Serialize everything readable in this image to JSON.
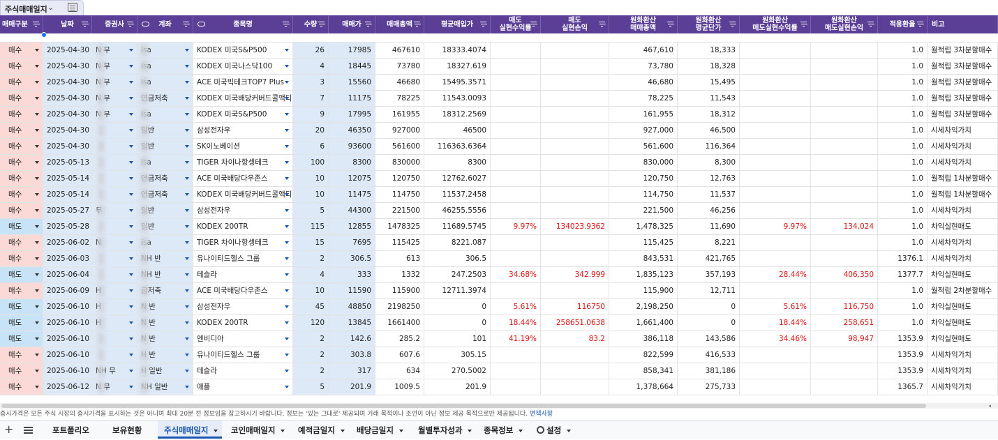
{
  "sheet_chip": {
    "name": "주식매매일지"
  },
  "headers": [
    "매매구분",
    "날짜",
    "증권사",
    "계좌",
    "종목명",
    "수량",
    "매매가",
    "매매총액",
    "평균매입가",
    "매도\n실현수익률",
    "매도\n실현손익",
    "원화환산\n매매총액",
    "원화환산\n평균단가",
    "원화환산\n매도실현수익률",
    "원화환산\n매도실현손익",
    "적용환율",
    "비고"
  ],
  "rows": [
    {
      "type": "매수",
      "date": "2025-04-30",
      "broker": "N  무",
      "account": "isa",
      "ticker": "KODEX 미국S&P500",
      "qty": "26",
      "price": "17985",
      "total": "467610",
      "avg": "18333.4074",
      "rr": "",
      "rp": "",
      "ktotal": "467,610",
      "kavg": "18,333",
      "krr": "",
      "krp": "",
      "fx": "1.0",
      "note": "월적립 3차분할매수"
    },
    {
      "type": "매수",
      "date": "2025-04-30",
      "broker": "N  무",
      "account": "isa",
      "ticker": "KODEX 미국나스닥100",
      "qty": "4",
      "price": "18445",
      "total": "73780",
      "avg": "18327.619",
      "rr": "",
      "rp": "",
      "ktotal": "73,780",
      "kavg": "18,328",
      "krr": "",
      "krp": "",
      "fx": "1.0",
      "note": "월적립 3차분할매수"
    },
    {
      "type": "매수",
      "date": "2025-04-30",
      "broker": "N  무",
      "account": "isa",
      "ticker": "ACE 미국빅테크TOP7 Plus",
      "qty": "3",
      "price": "15560",
      "total": "46680",
      "avg": "15495.3571",
      "rr": "",
      "rp": "",
      "ktotal": "46,680",
      "kavg": "15,495",
      "krr": "",
      "krp": "",
      "fx": "1.0",
      "note": "월적립 3차분할매수"
    },
    {
      "type": "매수",
      "date": "2025-04-30",
      "broker": "N  무",
      "account": "연금저축",
      "ticker": "KODEX 미국배당커버드콜액티!",
      "qty": "7",
      "price": "11175",
      "total": "78225",
      "avg": "11543.0093",
      "rr": "",
      "rp": "",
      "ktotal": "78,225",
      "kavg": "11,543",
      "krr": "",
      "krp": "",
      "fx": "1.0",
      "note": "월적립 3차분할매수"
    },
    {
      "type": "매수",
      "date": "2025-04-30",
      "broker": "N  무",
      "account": "isa",
      "ticker": "KODEX 미국S&P500",
      "qty": "9",
      "price": "17995",
      "total": "161955",
      "avg": "18312.2569",
      "rr": "",
      "rp": "",
      "ktotal": "161,955",
      "kavg": "18,312",
      "krr": "",
      "krp": "",
      "fx": "1.0",
      "note": "월적립 3차분할매수"
    },
    {
      "type": "매수",
      "date": "2025-04-30",
      "broker": "",
      "account": "일반",
      "ticker": "삼성전자우",
      "qty": "20",
      "price": "46350",
      "total": "927000",
      "avg": "46500",
      "rr": "",
      "rp": "",
      "ktotal": "927,000",
      "kavg": "46,500",
      "krr": "",
      "krp": "",
      "fx": "1.0",
      "note": "시세차익가치"
    },
    {
      "type": "매수",
      "date": "2025-04-30",
      "broker": "",
      "account": "일반",
      "ticker": "SK이노베이션",
      "qty": "6",
      "price": "93600",
      "total": "561600",
      "avg": "116363.6364",
      "rr": "",
      "rp": "",
      "ktotal": "561,600",
      "kavg": "116,364",
      "krr": "",
      "krp": "",
      "fx": "1.0",
      "note": "시세차익가치"
    },
    {
      "type": "매수",
      "date": "2025-05-13",
      "broker": "",
      "account": "isa",
      "ticker": "TIGER 차이나항셍테크",
      "qty": "100",
      "price": "8300",
      "total": "830000",
      "avg": "8300",
      "rr": "",
      "rp": "",
      "ktotal": "830,000",
      "kavg": "8,300",
      "krr": "",
      "krp": "",
      "fx": "1.0",
      "note": "시세차익가치"
    },
    {
      "type": "매수",
      "date": "2025-05-14",
      "broker": "",
      "account": "연금저축",
      "ticker": "ACE 미국배당다우존스",
      "qty": "10",
      "price": "12075",
      "total": "120750",
      "avg": "12762.6027",
      "rr": "",
      "rp": "",
      "ktotal": "120,750",
      "kavg": "12,763",
      "krr": "",
      "krp": "",
      "fx": "1.0",
      "note": "월적립 1차분할매수"
    },
    {
      "type": "매수",
      "date": "2025-05-14",
      "broker": "",
      "account": "연금저축",
      "ticker": "KODEX 미국배당커버드콜액티!",
      "qty": "10",
      "price": "11475",
      "total": "114750",
      "avg": "11537.2458",
      "rr": "",
      "rp": "",
      "ktotal": "114,750",
      "kavg": "11,537",
      "krr": "",
      "krp": "",
      "fx": "1.0",
      "note": "월적립 1차분할매수"
    },
    {
      "type": "매수",
      "date": "2025-05-27",
      "broker": "  무",
      "account": "일반",
      "ticker": "삼성전자우",
      "qty": "5",
      "price": "44300",
      "total": "221500",
      "avg": "46255.5556",
      "rr": "",
      "rp": "",
      "ktotal": "221,500",
      "kavg": "46,256",
      "krr": "",
      "krp": "",
      "fx": "1.0",
      "note": "시세차익가치"
    },
    {
      "type": "매도",
      "date": "2025-05-28",
      "broker": "",
      "account": "일반",
      "ticker": "KODEX 200TR",
      "qty": "115",
      "price": "12855",
      "total": "1478325",
      "avg": "11689.5745",
      "rr": "9.97%",
      "rp": "134023.9362",
      "ktotal": "1,478,325",
      "kavg": "11,690",
      "krr": "9.97%",
      "krp": "134,024",
      "fx": "1.0",
      "note": "차익실현매도"
    },
    {
      "type": "매수",
      "date": "2025-06-02",
      "broker": "N",
      "account": "isa",
      "ticker": "TIGER 차이나항셍테크",
      "qty": "15",
      "price": "7695",
      "total": "115425",
      "avg": "8221.087",
      "rr": "",
      "rp": "",
      "ktotal": "115,425",
      "kavg": "8,221",
      "krr": "",
      "krp": "",
      "fx": "1.0",
      "note": "시세차익가치"
    },
    {
      "type": "매수",
      "date": "2025-06-03",
      "broker": "",
      "account": "NH 반",
      "ticker": "유나이티드헬스 그룹",
      "qty": "2",
      "price": "306.5",
      "total": "613",
      "avg": "306.5",
      "rr": "",
      "rp": "",
      "ktotal": "843,531",
      "kavg": "421,765",
      "krr": "",
      "krp": "",
      "fx": "1376.1",
      "note": "시세차익가치"
    },
    {
      "type": "매도",
      "date": "2025-06-04",
      "broker": "",
      "account": "NH 반",
      "ticker": "테슬라",
      "qty": "4",
      "price": "333",
      "total": "1332",
      "avg": "247.2503",
      "rr": "34.68%",
      "rp": "342.999",
      "ktotal": "1,835,123",
      "kavg": "357,193",
      "krr": "28.44%",
      "krp": "406,350",
      "fx": "1377.7",
      "note": "차익실현매도"
    },
    {
      "type": "매수",
      "date": "2025-06-09",
      "broker": "H",
      "account": "금저축",
      "ticker": "ACE 미국배당다우존스",
      "qty": "10",
      "price": "11590",
      "total": "115900",
      "avg": "12711.3974",
      "rr": "",
      "rp": "",
      "ktotal": "115,900",
      "kavg": "12,711",
      "krr": "",
      "krp": "",
      "fx": "1.0",
      "note": "월적립 2차분할매수"
    },
    {
      "type": "매도",
      "date": "2025-06-10",
      "broker": "H",
      "account": "N 반",
      "ticker": "삼성전자우",
      "qty": "45",
      "price": "48850",
      "total": "2198250",
      "avg": "0",
      "rr": "5.61%",
      "rp": "116750",
      "ktotal": "2,198,250",
      "kavg": "0",
      "krr": "5.61%",
      "krp": "116,750",
      "fx": "1.0",
      "note": "차익실현매도"
    },
    {
      "type": "매도",
      "date": "2025-06-10",
      "broker": "H",
      "account": "N 반",
      "ticker": "KODEX 200TR",
      "qty": "120",
      "price": "13845",
      "total": "1661400",
      "avg": "0",
      "rr": "18.44%",
      "rp": "258651.0638",
      "ktotal": "1,661,400",
      "kavg": "0",
      "krr": "18.44%",
      "krp": "258,651",
      "fx": "1.0",
      "note": "차익실현매도"
    },
    {
      "type": "매도",
      "date": "2025-06-10",
      "broker": "",
      "account": "N 반",
      "ticker": "엔비디아",
      "qty": "2",
      "price": "142.6",
      "total": "285.2",
      "avg": "101",
      "rr": "41.19%",
      "rp": "83.2",
      "ktotal": "386,118",
      "kavg": "143,586",
      "krr": "34.46%",
      "krp": "98,947",
      "fx": "1353.9",
      "note": "차익실현매도"
    },
    {
      "type": "매수",
      "date": "2025-06-10",
      "broker": "",
      "account": "H 반",
      "ticker": "유나이티드헬스 그룹",
      "qty": "2",
      "price": "303.8",
      "total": "607.6",
      "avg": "305.15",
      "rr": "",
      "rp": "",
      "ktotal": "822,599",
      "kavg": "416,533",
      "krr": "",
      "krp": "",
      "fx": "1353.9",
      "note": "시세차익가치"
    },
    {
      "type": "매수",
      "date": "2025-06-10",
      "broker": "NH 무",
      "account": "H 일반",
      "ticker": "테슬라",
      "qty": "2",
      "price": "317",
      "total": "634",
      "avg": "270.5002",
      "rr": "",
      "rp": "",
      "ktotal": "858,341",
      "kavg": "381,186",
      "krr": "",
      "krp": "",
      "fx": "1353.9",
      "note": "시세차익가치"
    },
    {
      "type": "매수",
      "date": "2025-06-12",
      "broker": "N  무",
      "account": "NH 일반",
      "ticker": "애플",
      "qty": "5",
      "price": "201.9",
      "total": "1009.5",
      "avg": "201.9",
      "rr": "",
      "rp": "",
      "ktotal": "1,378,664",
      "kavg": "275,733",
      "krr": "",
      "krp": "",
      "fx": "1365.7",
      "note": "시세차익가치"
    }
  ],
  "disclaimer": {
    "text": "증시가격은 모든 주식 시장의 증시가격을 표시하는 것은 아니며 최대 20분 전 정보임을 참고하시기 바랍니다. 정보는 '있는 그대로' 제공되며 거래 목적이나 조언이 아닌 정보 제공 목적으로만 제공됩니다.",
    "link": "면책사항"
  },
  "tabs": [
    "포트폴리오",
    "보유현황",
    "주식매매일지",
    "코인매매일지",
    "예적금일지",
    "배당금일지",
    "월별투자성과",
    "종목정보",
    "설정"
  ],
  "colors": {
    "header": "#5b3f97",
    "buy": "#fbd9d6",
    "sell": "#c9e3f6",
    "active_tab": "#1a56b0",
    "negative": "#e01010"
  }
}
